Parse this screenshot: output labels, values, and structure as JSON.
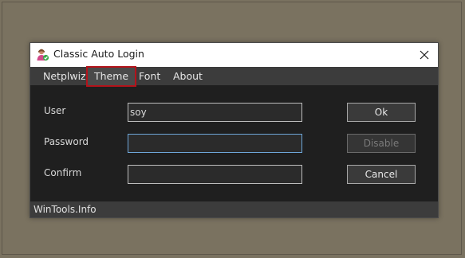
{
  "window": {
    "title": "Classic Auto Login",
    "app_icon": "user-check-icon",
    "close_icon": "close-icon"
  },
  "menu": {
    "items": [
      {
        "label": "Netplwiz"
      },
      {
        "label": "Theme",
        "selected": true
      },
      {
        "label": "Font"
      },
      {
        "label": "About"
      }
    ]
  },
  "form": {
    "user_label": "User",
    "user_value": "soy",
    "password_label": "Password",
    "password_value": "",
    "confirm_label": "Confirm",
    "confirm_value": ""
  },
  "buttons": {
    "ok": "Ok",
    "disable": "Disable",
    "cancel": "Cancel"
  },
  "status": {
    "text": "WinTools.Info"
  },
  "colors": {
    "desktop": "#7a7260",
    "window_body": "#1f1f1f",
    "menubar": "#3c3c3c",
    "highlight": "#b3131b"
  }
}
